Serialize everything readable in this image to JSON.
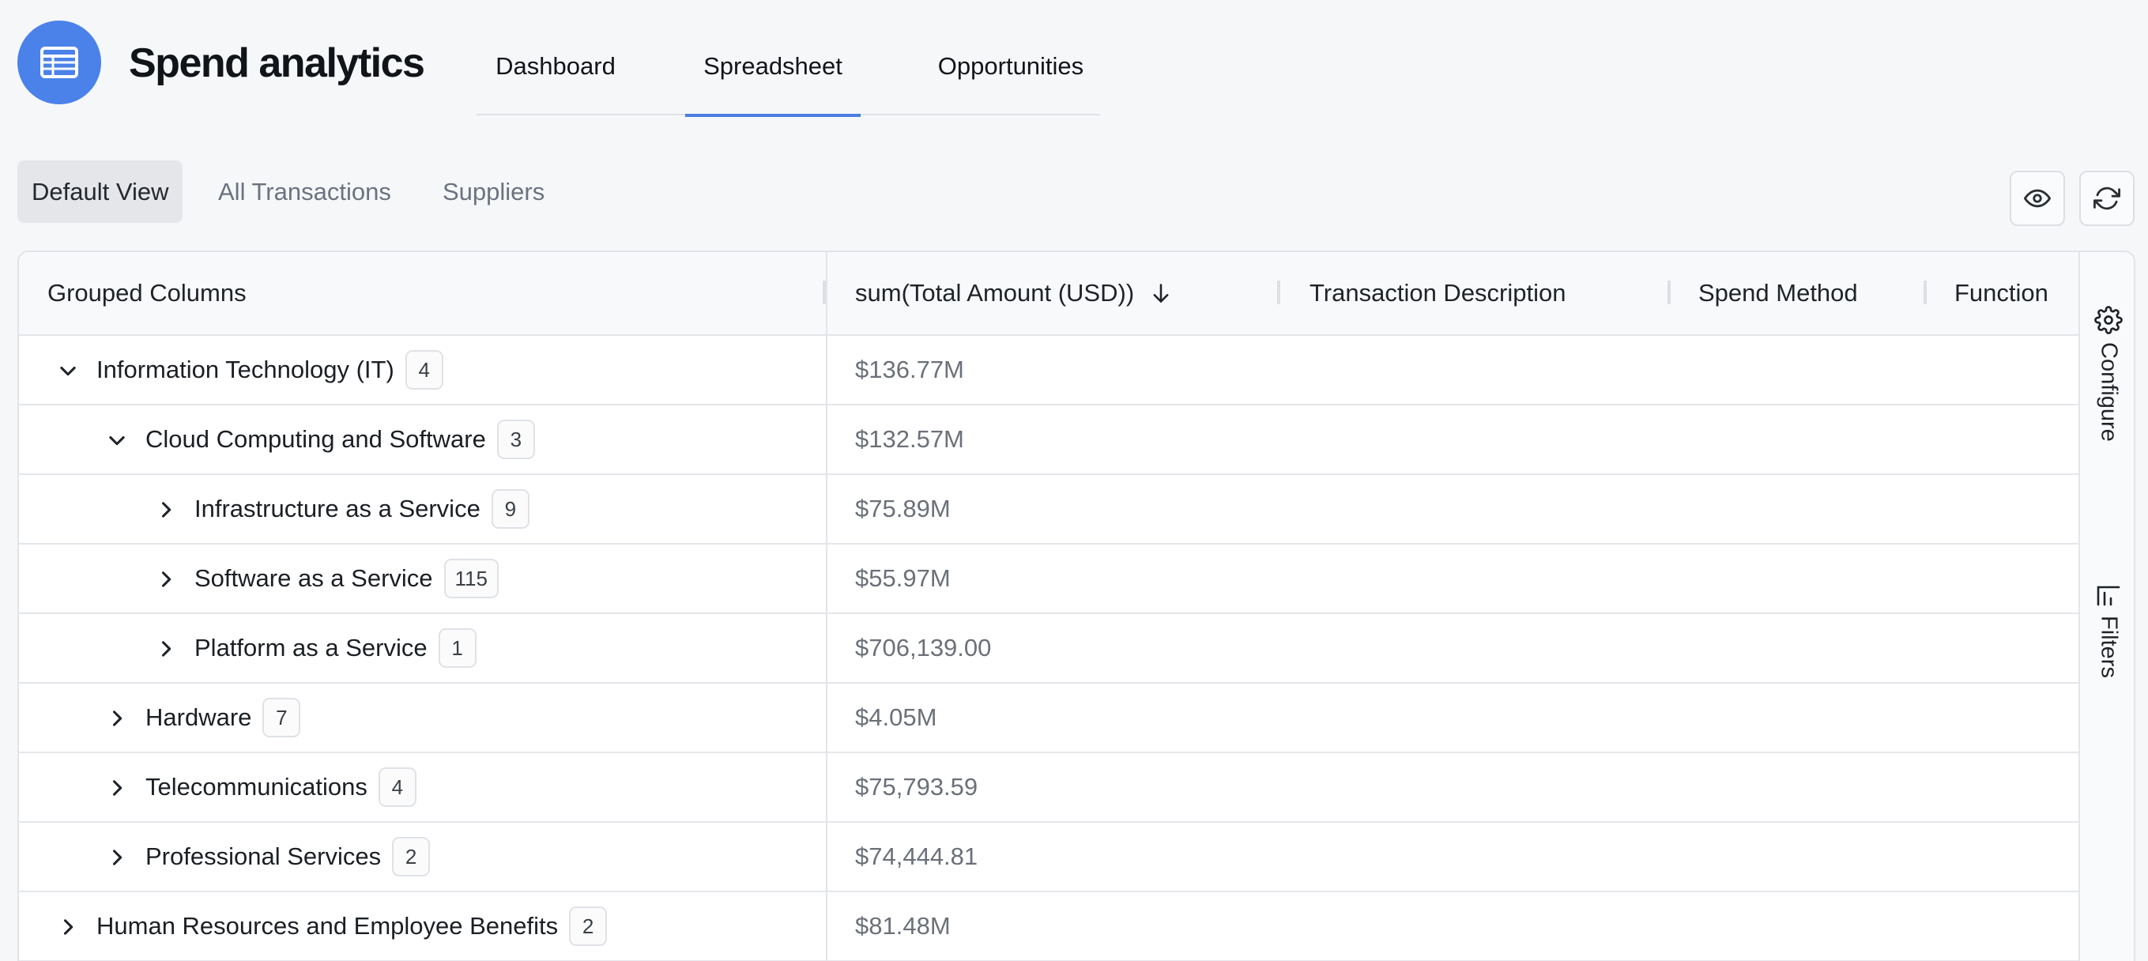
{
  "app": {
    "title": "Spend analytics",
    "logo_icon": "table-icon",
    "accent": "#4a82e9"
  },
  "nav": {
    "tabs": [
      {
        "label": "Dashboard",
        "active": false
      },
      {
        "label": "Spreadsheet",
        "active": true
      },
      {
        "label": "Opportunities",
        "active": false
      }
    ]
  },
  "views": {
    "tabs": [
      {
        "label": "Default View",
        "active": true
      },
      {
        "label": "All Transactions",
        "active": false
      },
      {
        "label": "Suppliers",
        "active": false
      }
    ],
    "actions": [
      {
        "icon": "eye-icon"
      },
      {
        "icon": "refresh-icon"
      }
    ]
  },
  "grid": {
    "columns": {
      "grouped": "Grouped Columns",
      "amount": "sum(Total Amount (USD))",
      "amount_sort": "descending",
      "description": "Transaction Description",
      "spend_method": "Spend Method",
      "function": "Function"
    },
    "rows": [
      {
        "name": "Information Technology (IT)",
        "count": "4",
        "amount": "$136.77M",
        "level": 0,
        "expanded": true
      },
      {
        "name": "Cloud Computing and Software",
        "count": "3",
        "amount": "$132.57M",
        "level": 1,
        "expanded": true
      },
      {
        "name": "Infrastructure as a Service",
        "count": "9",
        "amount": "$75.89M",
        "level": 2,
        "expanded": false
      },
      {
        "name": "Software as a Service",
        "count": "115",
        "amount": "$55.97M",
        "level": 2,
        "expanded": false
      },
      {
        "name": "Platform as a Service",
        "count": "1",
        "amount": "$706,139.00",
        "level": 2,
        "expanded": false
      },
      {
        "name": "Hardware",
        "count": "7",
        "amount": "$4.05M",
        "level": 1,
        "expanded": false
      },
      {
        "name": "Telecommunications",
        "count": "4",
        "amount": "$75,793.59",
        "level": 1,
        "expanded": false
      },
      {
        "name": "Professional Services",
        "count": "2",
        "amount": "$74,444.81",
        "level": 1,
        "expanded": false
      },
      {
        "name": "Human Resources and Employee Benefits",
        "count": "2",
        "amount": "$81.48M",
        "level": 0,
        "expanded": false
      }
    ]
  },
  "side_panel": {
    "configure": "Configure",
    "filters": "Filters"
  }
}
